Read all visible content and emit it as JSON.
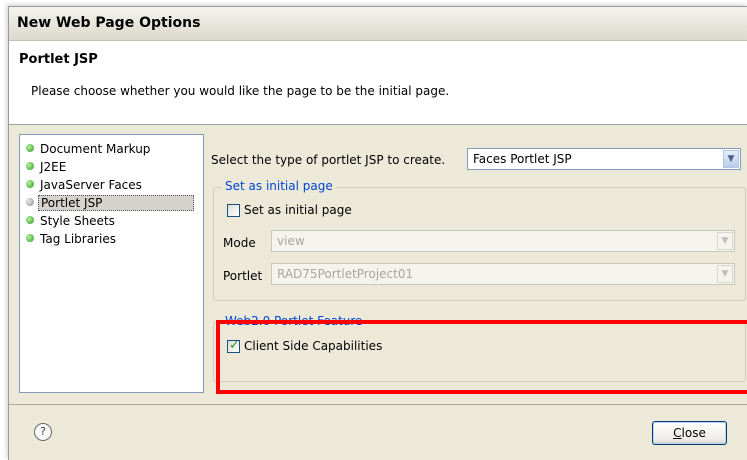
{
  "window": {
    "title": "New Web Page Options"
  },
  "header": {
    "title": "Portlet JSP",
    "description": "Please choose whether you would like the page to be the initial page."
  },
  "nav": {
    "items": [
      {
        "label": "Document Markup",
        "selected": false
      },
      {
        "label": "J2EE",
        "selected": false
      },
      {
        "label": "JavaServer Faces",
        "selected": false
      },
      {
        "label": "Portlet JSP",
        "selected": true
      },
      {
        "label": "Style Sheets",
        "selected": false
      },
      {
        "label": "Tag Libraries",
        "selected": false
      }
    ]
  },
  "portlet_type": {
    "label": "Select the type of portlet JSP to create.",
    "value": "Faces Portlet JSP"
  },
  "initial_page_group": {
    "legend": "Set as initial page",
    "checkbox_label": "Set as initial page",
    "checked": false,
    "mode_label": "Mode",
    "mode_value": "view",
    "portlet_label": "Portlet",
    "portlet_value": "RAD75PortletProject01"
  },
  "web20_group": {
    "legend": "Web2.0 Portlet Feature",
    "checkbox_label": "Client Side Capabilities",
    "checked": true
  },
  "footer": {
    "help_symbol": "?",
    "close_first": "C",
    "close_rest": "lose"
  },
  "colors": {
    "highlight_border": "#ff0000",
    "group_legend": "#0046d5",
    "nav_dot_active": "#2e9a21"
  }
}
